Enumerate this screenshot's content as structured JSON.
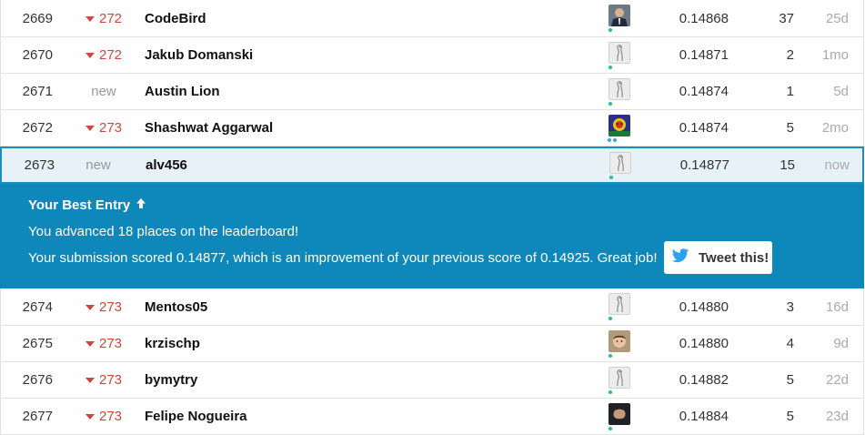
{
  "rows_top": [
    {
      "rank": "2669",
      "change": "272",
      "change_type": "down",
      "team": "CodeBird",
      "avatar": "photo-suit",
      "score": "0.14868",
      "entries": "37",
      "last": "25d"
    },
    {
      "rank": "2670",
      "change": "272",
      "change_type": "down",
      "team": "Jakub Domanski",
      "avatar": "default-goose",
      "score": "0.14871",
      "entries": "2",
      "last": "1mo"
    },
    {
      "rank": "2671",
      "change": "new",
      "change_type": "new",
      "team": "Austin Lion",
      "avatar": "default-goose",
      "score": "0.14874",
      "entries": "1",
      "last": "5d"
    },
    {
      "rank": "2672",
      "change": "273",
      "change_type": "down",
      "team": "Shashwat Aggarwal",
      "avatar": "photo-colorful",
      "score": "0.14874",
      "entries": "5",
      "last": "2mo"
    }
  ],
  "current_row": {
    "rank": "2673",
    "change": "new",
    "change_type": "new",
    "team": "alv456",
    "avatar": "default-goose",
    "score": "0.14877",
    "entries": "15",
    "last": "now"
  },
  "best_entry": {
    "title": "Your Best Entry",
    "title_icon": "arrow-up-icon",
    "message1": "You advanced 18 places on the leaderboard!",
    "message2": "Your submission scored 0.14877, which is an improvement of your previous score of 0.14925. Great job!",
    "tweet_label": "Tweet this!",
    "tweet_icon": "twitter-bird-icon"
  },
  "rows_bottom": [
    {
      "rank": "2674",
      "change": "273",
      "change_type": "down",
      "team": "Mentos05",
      "avatar": "default-goose",
      "score": "0.14880",
      "entries": "3",
      "last": "16d"
    },
    {
      "rank": "2675",
      "change": "273",
      "change_type": "down",
      "team": "krzischp",
      "avatar": "photo-face",
      "score": "0.14880",
      "entries": "4",
      "last": "9d"
    },
    {
      "rank": "2676",
      "change": "273",
      "change_type": "down",
      "team": "bymytry",
      "avatar": "default-goose",
      "score": "0.14882",
      "entries": "5",
      "last": "22d"
    },
    {
      "rank": "2677",
      "change": "273",
      "change_type": "down",
      "team": "Felipe Nogueira",
      "avatar": "photo-dark",
      "score": "0.14884",
      "entries": "5",
      "last": "23d"
    }
  ],
  "colors": {
    "accent": "#0e88bb",
    "current_row_bg": "#e6f2f8",
    "rank_down": "#c9483e",
    "tier_dot": "#20beaa",
    "tier_dot_blue": "#3aa7d9"
  }
}
